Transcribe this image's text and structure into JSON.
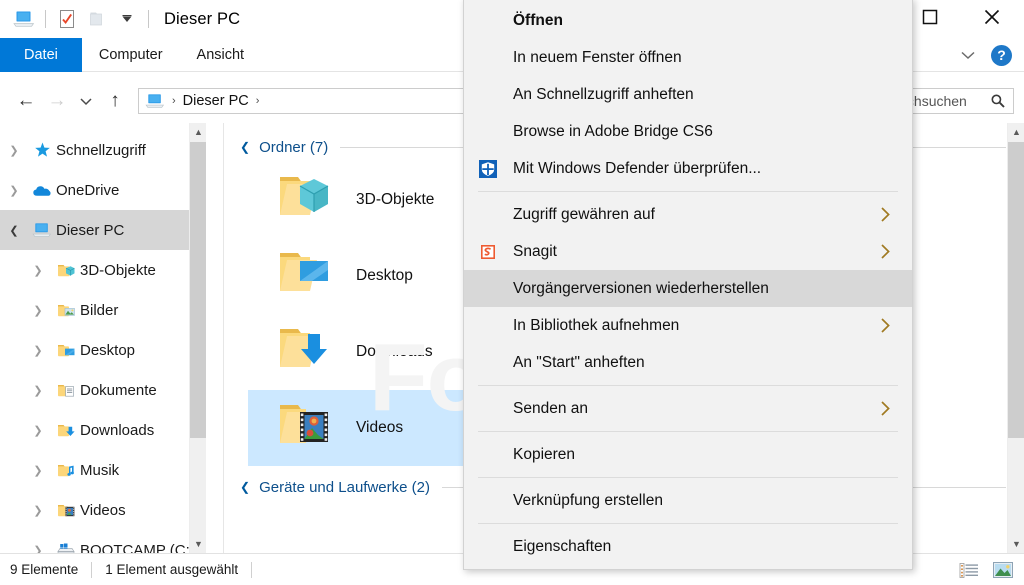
{
  "window": {
    "title": "Dieser PC",
    "quick_access": [
      "this-pc-icon",
      "properties-icon",
      "new-folder-icon",
      "customize-dropdown-icon"
    ],
    "controls": {
      "minimize": "—",
      "maximize": "☐",
      "close": "✕"
    }
  },
  "ribbon": {
    "tabs": [
      {
        "label": "Datei",
        "active": true
      },
      {
        "label": "Computer",
        "active": false
      },
      {
        "label": "Ansicht",
        "active": false
      }
    ],
    "collapse_icon": "chevron-down-icon",
    "help_label": "?"
  },
  "address": {
    "back_icon": "←",
    "forward_icon": "→",
    "recent_icon": "⌄",
    "up_icon": "↑",
    "breadcrumb": [
      "Dieser PC"
    ],
    "separator": "›",
    "search_placeholder": "Dieser PC durchsuchen",
    "search_value": "",
    "search_icon": "search-icon"
  },
  "navpane": {
    "items": [
      {
        "label": "Schnellzugriff",
        "icon": "star-pin-icon",
        "level": 1,
        "expanded": false,
        "selected": false
      },
      {
        "label": "OneDrive",
        "icon": "onedrive-cloud-icon",
        "level": 1,
        "expanded": false,
        "selected": false
      },
      {
        "label": "Dieser PC",
        "icon": "this-pc-icon",
        "level": 1,
        "expanded": true,
        "selected": true
      },
      {
        "label": "3D-Objekte",
        "icon": "folder-3d-icon",
        "level": 2,
        "expanded": false,
        "selected": false
      },
      {
        "label": "Bilder",
        "icon": "folder-pictures-icon",
        "level": 2,
        "expanded": false,
        "selected": false
      },
      {
        "label": "Desktop",
        "icon": "folder-desktop-icon",
        "level": 2,
        "expanded": false,
        "selected": false
      },
      {
        "label": "Dokumente",
        "icon": "folder-documents-icon",
        "level": 2,
        "expanded": false,
        "selected": false
      },
      {
        "label": "Downloads",
        "icon": "folder-downloads-icon",
        "level": 2,
        "expanded": false,
        "selected": false
      },
      {
        "label": "Musik",
        "icon": "folder-music-icon",
        "level": 2,
        "expanded": false,
        "selected": false
      },
      {
        "label": "Videos",
        "icon": "folder-videos-icon",
        "level": 2,
        "expanded": false,
        "selected": false
      },
      {
        "label": "BOOTCAMP (C:)",
        "icon": "hard-drive-windows-icon",
        "level": 2,
        "expanded": false,
        "selected": false
      }
    ]
  },
  "content": {
    "watermark": "FonePaw",
    "groups": [
      {
        "title": "Ordner (7)",
        "items": [
          {
            "label": "3D-Objekte",
            "icon": "folder-3d-icon",
            "selected": false
          },
          {
            "label": "Desktop",
            "icon": "folder-desktop-icon",
            "selected": false
          },
          {
            "label": "Downloads",
            "icon": "folder-downloads-icon",
            "selected": false
          },
          {
            "label": "Videos",
            "icon": "folder-videos-icon",
            "selected": true
          }
        ]
      },
      {
        "title": "Geräte und Laufwerke (2)",
        "items": []
      }
    ]
  },
  "context_menu": {
    "items": [
      {
        "label": "Öffnen",
        "bold": true,
        "icon": null,
        "submenu": false,
        "highlighted": false,
        "separator_after": false
      },
      {
        "label": "In neuem Fenster öffnen",
        "bold": false,
        "icon": null,
        "submenu": false,
        "highlighted": false,
        "separator_after": false
      },
      {
        "label": "An Schnellzugriff anheften",
        "bold": false,
        "icon": null,
        "submenu": false,
        "highlighted": false,
        "separator_after": false
      },
      {
        "label": "Browse in Adobe Bridge CS6",
        "bold": false,
        "icon": null,
        "submenu": false,
        "highlighted": false,
        "separator_after": false
      },
      {
        "label": "Mit Windows Defender überprüfen...",
        "bold": false,
        "icon": "windows-defender-shield-icon",
        "submenu": false,
        "highlighted": false,
        "separator_after": true
      },
      {
        "label": "Zugriff gewähren auf",
        "bold": false,
        "icon": null,
        "submenu": true,
        "highlighted": false,
        "separator_after": false
      },
      {
        "label": "Snagit",
        "bold": false,
        "icon": "snagit-icon",
        "submenu": true,
        "highlighted": false,
        "separator_after": false
      },
      {
        "label": "Vorgängerversionen wiederherstellen",
        "bold": false,
        "icon": null,
        "submenu": false,
        "highlighted": true,
        "separator_after": false
      },
      {
        "label": "In Bibliothek aufnehmen",
        "bold": false,
        "icon": null,
        "submenu": true,
        "highlighted": false,
        "separator_after": false
      },
      {
        "label": "An \"Start\" anheften",
        "bold": false,
        "icon": null,
        "submenu": false,
        "highlighted": false,
        "separator_after": true
      },
      {
        "label": "Senden an",
        "bold": false,
        "icon": null,
        "submenu": true,
        "highlighted": false,
        "separator_after": true
      },
      {
        "label": "Kopieren",
        "bold": false,
        "icon": null,
        "submenu": false,
        "highlighted": false,
        "separator_after": true
      },
      {
        "label": "Verknüpfung erstellen",
        "bold": false,
        "icon": null,
        "submenu": false,
        "highlighted": false,
        "separator_after": true
      },
      {
        "label": "Eigenschaften",
        "bold": false,
        "icon": null,
        "submenu": false,
        "highlighted": false,
        "separator_after": false
      }
    ],
    "submenu_arrow": "›"
  },
  "statusbar": {
    "item_count": "9 Elemente",
    "selection": "1 Element ausgewählt",
    "views": [
      "details-view-icon",
      "large-icons-view-icon"
    ]
  },
  "colors": {
    "accent": "#0078d7",
    "selection": "#cce8ff",
    "group_header": "#0d4f8b",
    "menu_bg": "#f2f2f2",
    "menu_highlight": "#d8d8d8"
  }
}
